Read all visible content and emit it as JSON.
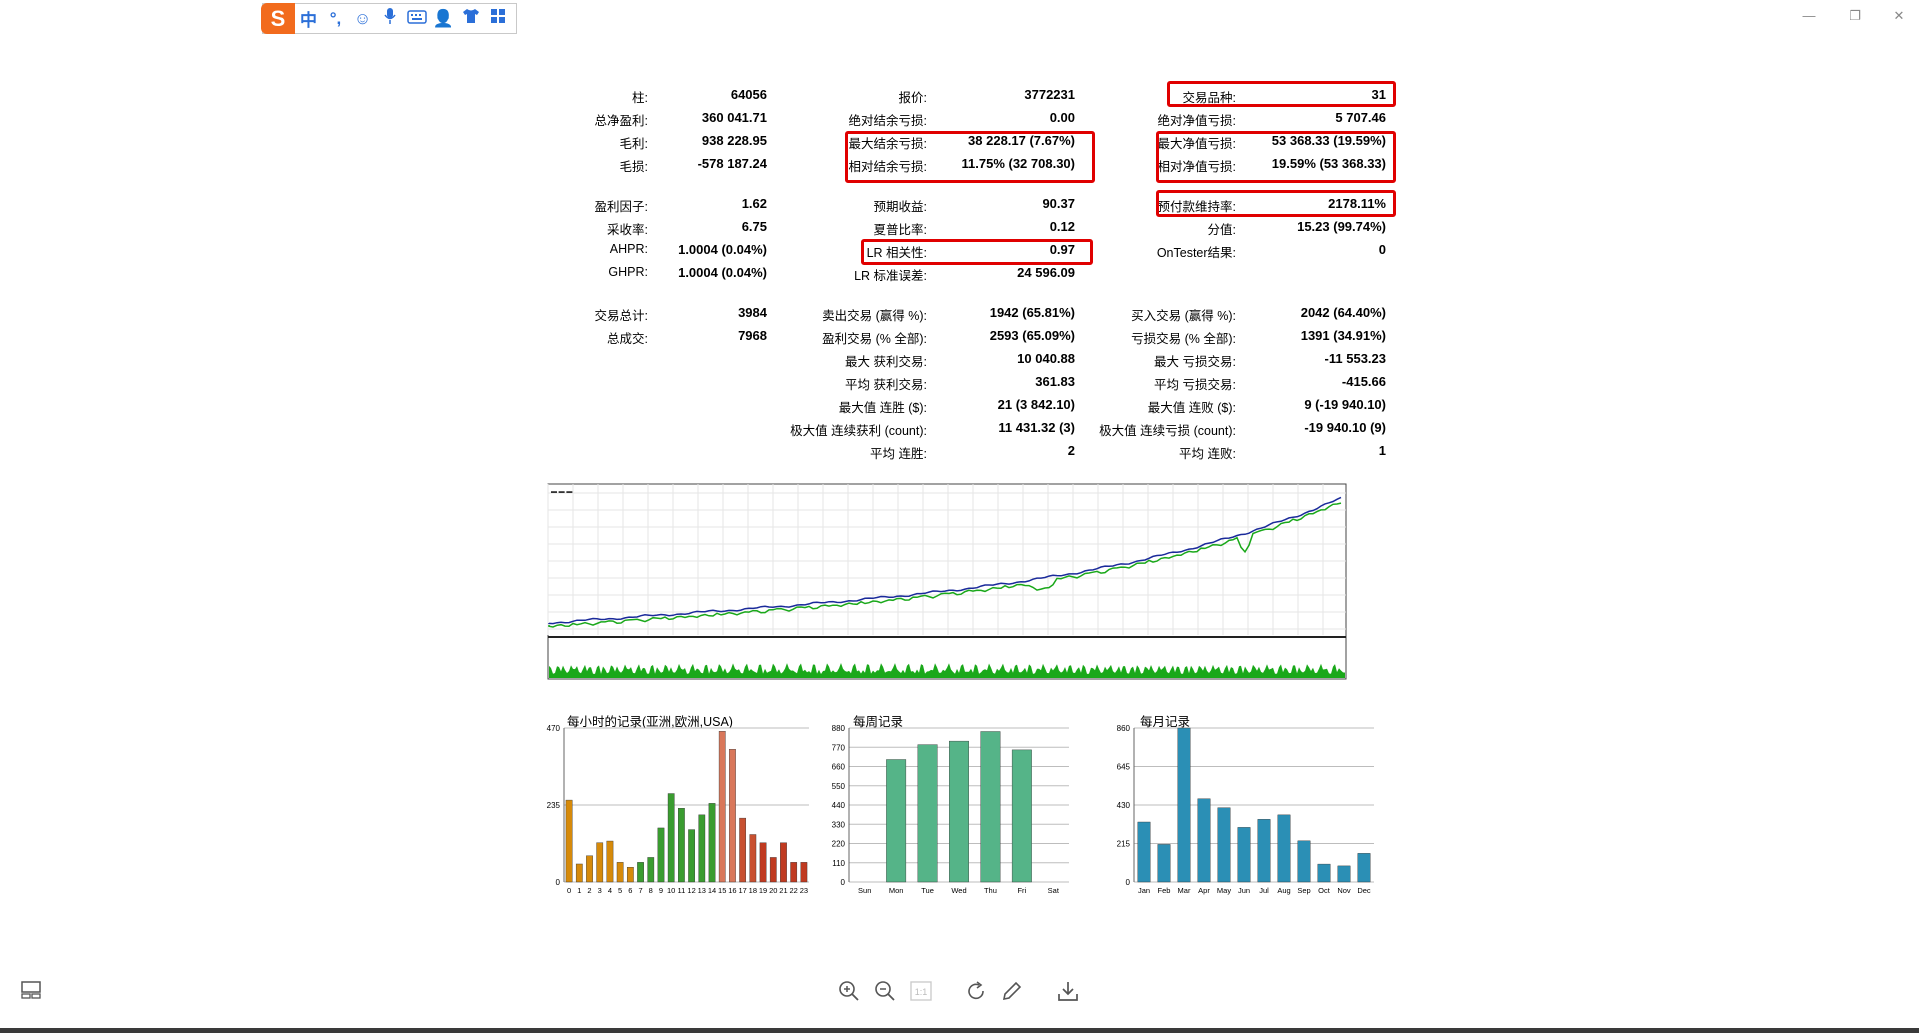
{
  "ime": {
    "logo": "S",
    "items": [
      "中",
      "°,",
      "☺",
      "mic",
      "kbd",
      "user",
      "shirt",
      "grid"
    ]
  },
  "stats": [
    {
      "label": "柱:",
      "value": "64056",
      "x": 0,
      "y": 95
    },
    {
      "label": "总净盈利:",
      "value": "360 041.71",
      "x": 0,
      "y": 118
    },
    {
      "label": "毛利:",
      "value": "938 228.95",
      "x": 0,
      "y": 141
    },
    {
      "label": "毛损:",
      "value": "-578 187.24",
      "x": 0,
      "y": 164
    },
    {
      "label": "盈利因子:",
      "value": "1.62",
      "x": 0,
      "y": 204
    },
    {
      "label": "采收率:",
      "value": "6.75",
      "x": 0,
      "y": 227
    },
    {
      "label": "AHPR:",
      "value": "1.0004 (0.04%)",
      "x": 0,
      "y": 250
    },
    {
      "label": "GHPR:",
      "value": "1.0004 (0.04%)",
      "x": 0,
      "y": 273
    },
    {
      "label": "交易总计:",
      "value": "3984",
      "x": 0,
      "y": 313
    },
    {
      "label": "总成交:",
      "value": "7968",
      "x": 0,
      "y": 336
    },
    {
      "label": "报价:",
      "value": "3772231",
      "x": 1,
      "y": 95
    },
    {
      "label": "绝对结余亏损:",
      "value": "0.00",
      "x": 1,
      "y": 118
    },
    {
      "label": "最大结余亏损:",
      "value": "38 228.17 (7.67%)",
      "x": 1,
      "y": 141
    },
    {
      "label": "相对结余亏损:",
      "value": "11.75% (32 708.30)",
      "x": 1,
      "y": 164
    },
    {
      "label": "预期收益:",
      "value": "90.37",
      "x": 1,
      "y": 204
    },
    {
      "label": "夏普比率:",
      "value": "0.12",
      "x": 1,
      "y": 227
    },
    {
      "label": "LR 相关性:",
      "value": "0.97",
      "x": 1,
      "y": 250
    },
    {
      "label": "LR 标准误差:",
      "value": "24 596.09",
      "x": 1,
      "y": 273
    },
    {
      "label": "卖出交易 (赢得 %):",
      "value": "1942 (65.81%)",
      "x": 1,
      "y": 313
    },
    {
      "label": "盈利交易 (% 全部):",
      "value": "2593 (65.09%)",
      "x": 1,
      "y": 336
    },
    {
      "label": "最大 获利交易:",
      "value": "10 040.88",
      "x": 1,
      "y": 359
    },
    {
      "label": "平均 获利交易:",
      "value": "361.83",
      "x": 1,
      "y": 382
    },
    {
      "label": "最大值 连胜 ($):",
      "value": "21 (3 842.10)",
      "x": 1,
      "y": 405
    },
    {
      "label": "极大值 连续获利 (count):",
      "value": "11 431.32 (3)",
      "x": 1,
      "y": 428
    },
    {
      "label": "平均 连胜:",
      "value": "2",
      "x": 1,
      "y": 451
    },
    {
      "label": "交易品种:",
      "value": "31",
      "x": 2,
      "y": 95
    },
    {
      "label": "绝对净值亏损:",
      "value": "5 707.46",
      "x": 2,
      "y": 118
    },
    {
      "label": "最大净值亏损:",
      "value": "53 368.33 (19.59%)",
      "x": 2,
      "y": 141
    },
    {
      "label": "相对净值亏损:",
      "value": "19.59% (53 368.33)",
      "x": 2,
      "y": 164
    },
    {
      "label": "预付款维持率:",
      "value": "2178.11%",
      "x": 2,
      "y": 204
    },
    {
      "label": "分值:",
      "value": "15.23 (99.74%)",
      "x": 2,
      "y": 227
    },
    {
      "label": "OnTester结果:",
      "value": "0",
      "x": 2,
      "y": 250
    },
    {
      "label": "买入交易 (赢得 %):",
      "value": "2042 (64.40%)",
      "x": 2,
      "y": 313
    },
    {
      "label": "亏损交易 (% 全部):",
      "value": "1391 (34.91%)",
      "x": 2,
      "y": 336
    },
    {
      "label": "最大 亏损交易:",
      "value": "-11 553.23",
      "x": 2,
      "y": 359
    },
    {
      "label": "平均 亏损交易:",
      "value": "-415.66",
      "x": 2,
      "y": 382
    },
    {
      "label": "最大值 连败 ($):",
      "value": "9 (-19 940.10)",
      "x": 2,
      "y": 405
    },
    {
      "label": "极大值 连续亏损 (count):",
      "value": "-19 940.10 (9)",
      "x": 2,
      "y": 428
    },
    {
      "label": "平均 连败:",
      "value": "1",
      "x": 2,
      "y": 451
    }
  ],
  "chart_data": [
    {
      "type": "bar",
      "title": "每小时的记录(亚洲,欧洲,USA)",
      "categories": [
        "0",
        "1",
        "2",
        "3",
        "4",
        "5",
        "6",
        "7",
        "8",
        "9",
        "10",
        "11",
        "12",
        "13",
        "14",
        "15",
        "16",
        "17",
        "18",
        "19",
        "20",
        "21",
        "22",
        "23"
      ],
      "values": [
        250,
        55,
        80,
        120,
        125,
        60,
        45,
        60,
        75,
        165,
        270,
        225,
        160,
        205,
        240,
        460,
        405,
        195,
        145,
        120,
        75,
        120,
        60,
        60
      ],
      "yticks": [
        "0",
        "235",
        "470"
      ],
      "ylim": [
        0,
        470
      ],
      "colors": [
        "#d68a0a",
        "#d68a0a",
        "#d68a0a",
        "#d68a0a",
        "#d68a0a",
        "#d68a0a",
        "#d68a0a",
        "#3a9c30",
        "#3a9c30",
        "#3a9c30",
        "#3a9c30",
        "#3a9c30",
        "#3a9c30",
        "#3a9c30",
        "#3a9c30",
        "#d9775a",
        "#d9775a",
        "#c85030",
        "#c85030",
        "#c03a20",
        "#c03a20",
        "#c03a20",
        "#c03a20",
        "#c03a20"
      ]
    },
    {
      "type": "bar",
      "title": "每周记录",
      "categories": [
        "Sun",
        "Mon",
        "Tue",
        "Wed",
        "Thu",
        "Fri",
        "Sat"
      ],
      "values": [
        0,
        700,
        785,
        805,
        860,
        755,
        0
      ],
      "yticks": [
        "0",
        "110",
        "220",
        "330",
        "440",
        "550",
        "660",
        "770",
        "880"
      ],
      "ylim": [
        0,
        880
      ],
      "colors": [
        "#55b488"
      ]
    },
    {
      "type": "bar",
      "title": "每月记录",
      "categories": [
        "Jan",
        "Feb",
        "Mar",
        "Apr",
        "May",
        "Jun",
        "Jul",
        "Aug",
        "Sep",
        "Oct",
        "Nov",
        "Dec"
      ],
      "values": [
        335,
        210,
        860,
        465,
        415,
        305,
        350,
        375,
        230,
        100,
        90,
        160
      ],
      "yticks": [
        "0",
        "215",
        "430",
        "645",
        "860"
      ],
      "ylim": [
        0,
        860
      ],
      "colors": [
        "#2b8fb5"
      ]
    }
  ],
  "toolbar": [
    "zoom-in",
    "zoom-out",
    "1:1",
    "rotate",
    "edit",
    "download"
  ]
}
